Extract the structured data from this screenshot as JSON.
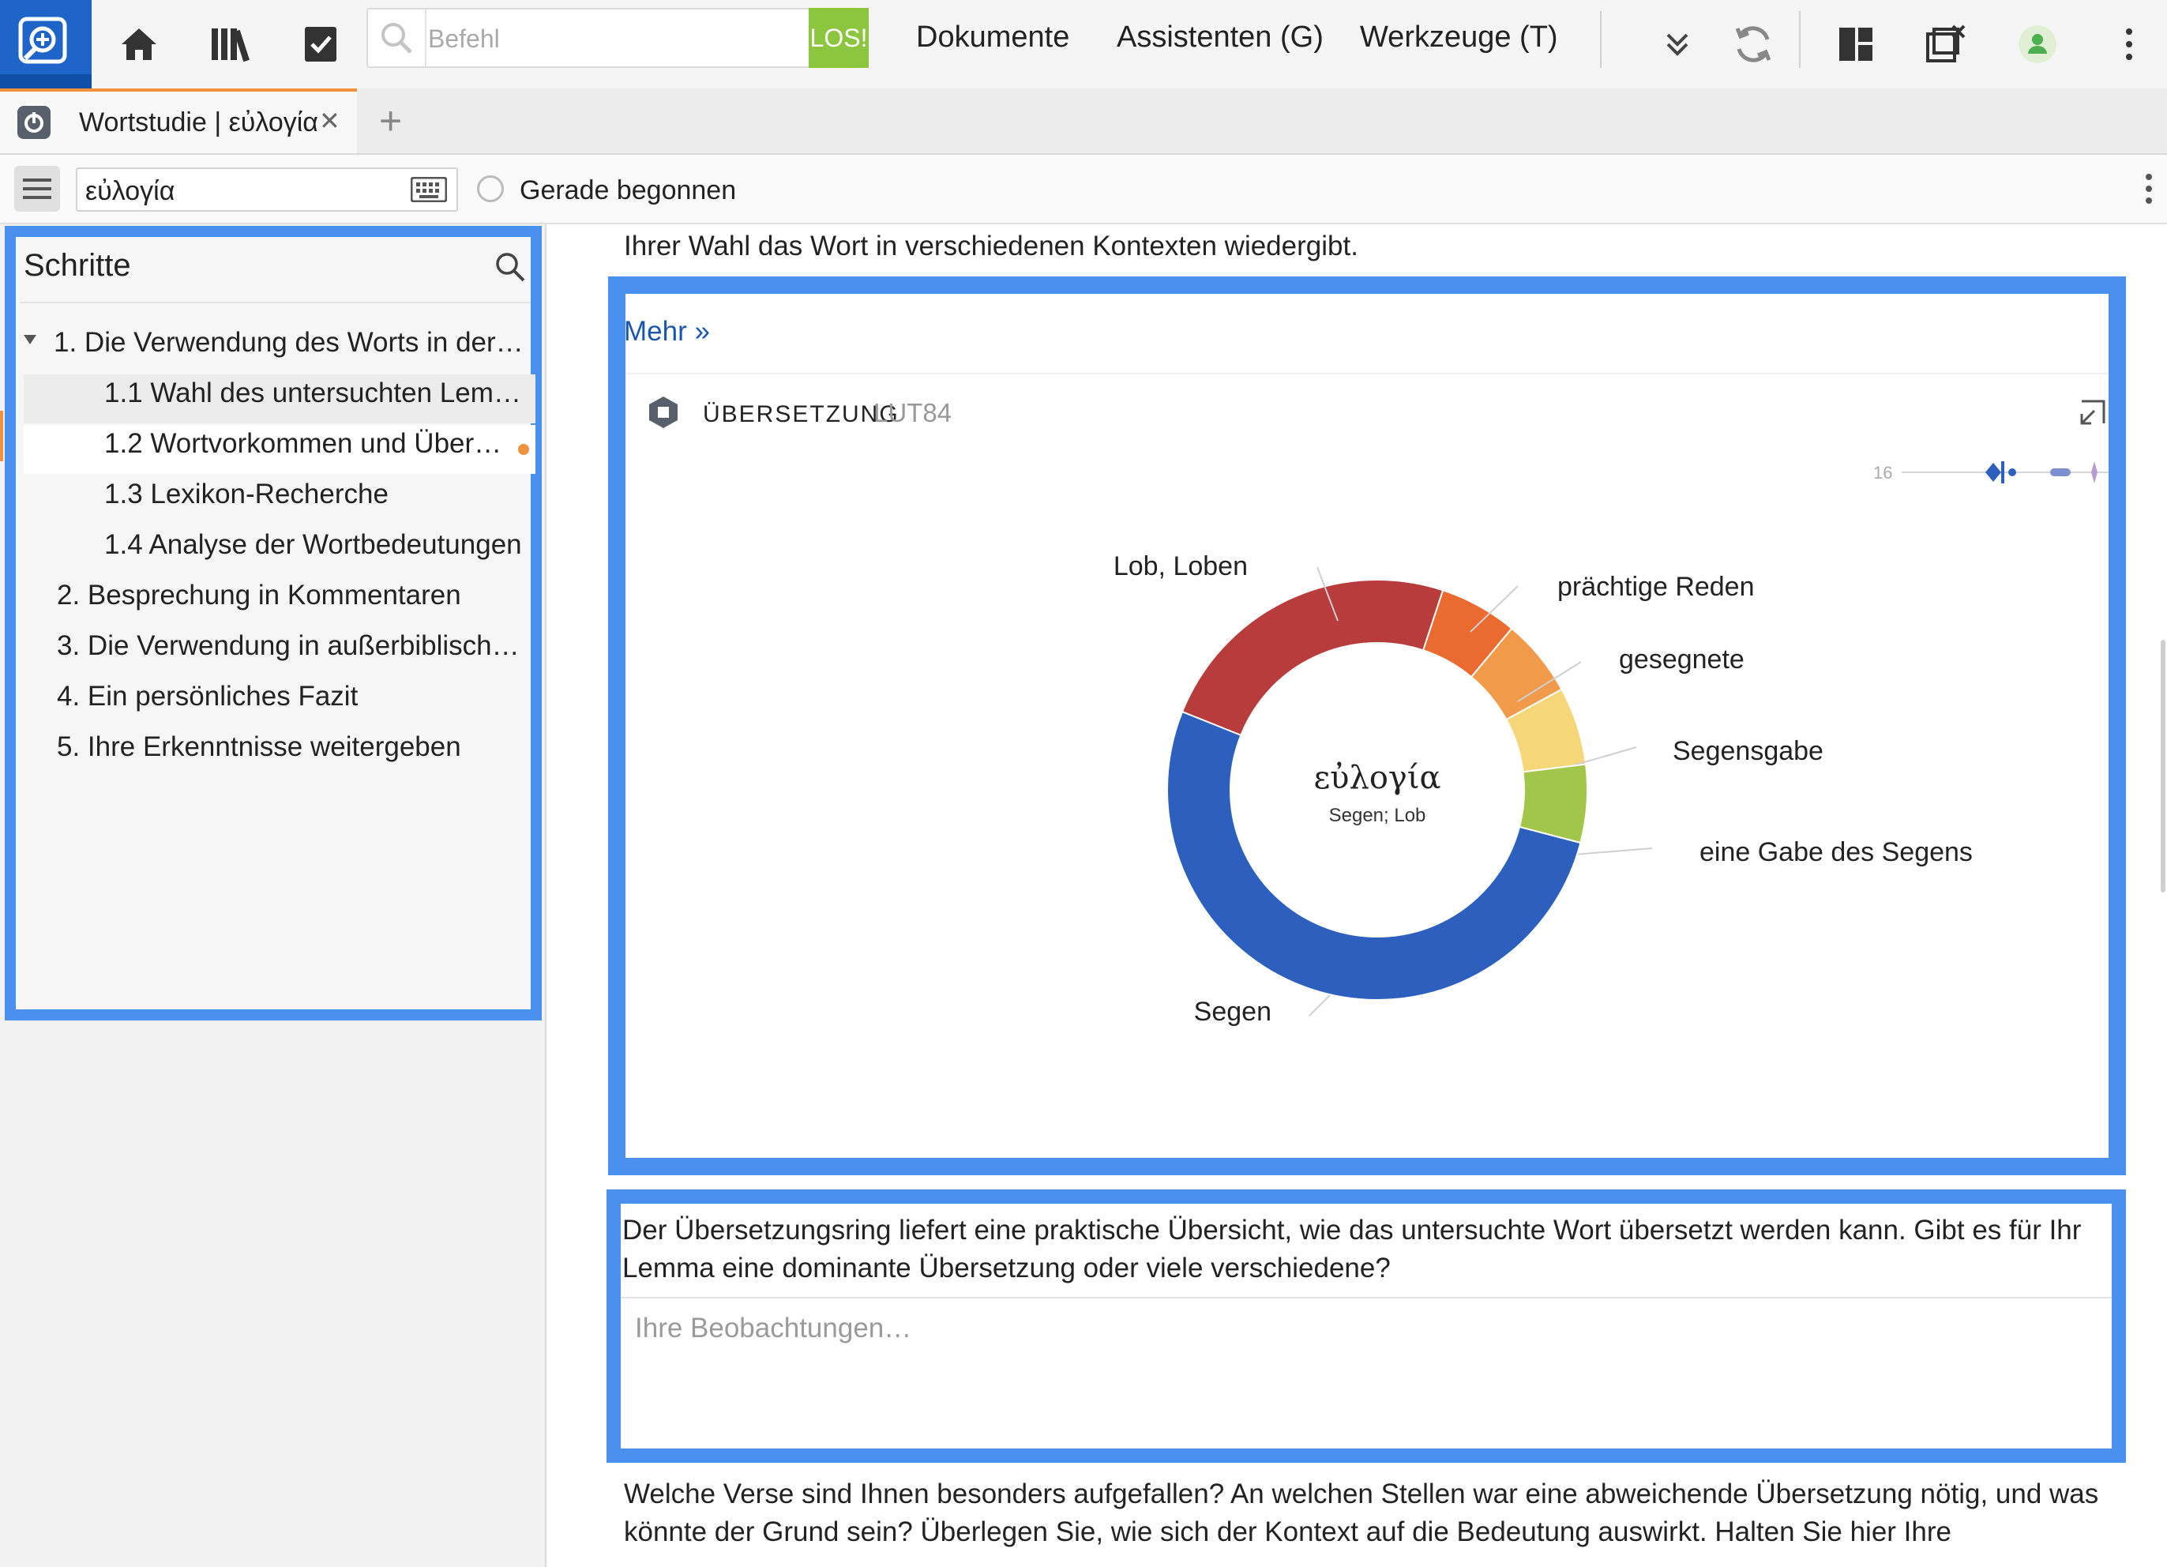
{
  "toolbar": {
    "command_placeholder": "Befehl",
    "go_label": "LOS!",
    "menu": [
      "Dokumente",
      "Assistenten (G)",
      "Werkzeuge (T)"
    ]
  },
  "tab": {
    "title": "Wortstudie | εὐλογία",
    "close": "✕",
    "add": "+"
  },
  "search": {
    "lemma": "εὐλογία",
    "status": "Gerade begonnen"
  },
  "sidebar": {
    "title": "Schritte",
    "steps": [
      {
        "label": "1. Die Verwendung des Worts in der…"
      },
      {
        "label": "1.1 Wahl des untersuchten Lem…"
      },
      {
        "label": "1.2 Wortvorkommen und Über…"
      },
      {
        "label": "1.3 Lexikon-Recherche"
      },
      {
        "label": "1.4 Analyse der Wortbedeutungen"
      },
      {
        "label": "2. Besprechung in Kommentaren"
      },
      {
        "label": "3. Die Verwendung in außerbiblisch…"
      },
      {
        "label": "4. Ein persönliches Fazit"
      },
      {
        "label": "5. Ihre Erkenntnisse weitergeben"
      }
    ]
  },
  "main": {
    "intro_text": "Ihrer Wahl das Wort in verschiedenen Kontexten wiedergibt.",
    "more_link": "Mehr »",
    "chart_panel": {
      "label": "ÜBERSETZUNG",
      "version": "LUT84",
      "sparkline_count": "16",
      "center_word": "εὐλογία",
      "center_gloss": "Segen; Lob"
    },
    "notes": {
      "question": "Der Übersetzungsring liefert eine praktische Übersicht, wie das untersuchte Wort übersetzt werden kann. Gibt es für Ihr Lemma eine dominante Übersetzung oder viele verschiedene?",
      "placeholder": "Ihre Beobachtungen…"
    },
    "bottom_text": "Welche Verse sind Ihnen besonders aufgefallen? An welchen Stellen war eine abweichende Übersetzung nötig, und was könnte der Grund sein? Überlegen Sie, wie sich der Kontext auf die Bedeutung auswirkt. Halten Sie hier Ihre"
  },
  "chart_data": {
    "type": "pie",
    "categories": [
      "Lob, Loben",
      "prächtige Reden",
      "gesegnete",
      "Segensgabe",
      "eine Gabe des Segens",
      "Segen"
    ],
    "values": [
      24,
      6,
      6,
      6,
      6,
      52
    ],
    "colors": [
      "#b93c3c",
      "#eb6a2f",
      "#f09a4a",
      "#f5d77a",
      "#a2c64a",
      "#2d5fbf"
    ]
  },
  "colors": {
    "accent": "#4a90ef",
    "brand": "#1f64c8",
    "go": "#8cc63f",
    "tab_accent": "#f0913d"
  }
}
